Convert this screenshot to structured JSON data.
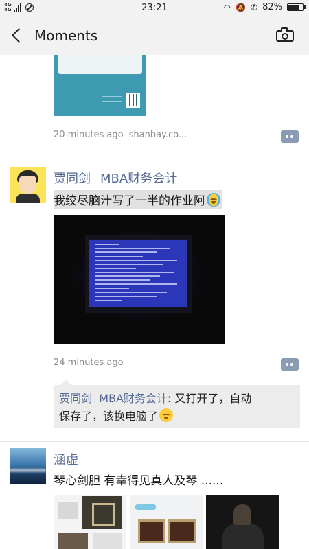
{
  "status_bar": {
    "network_top": "4G",
    "network_bottom": "4G",
    "time": "23:21",
    "battery": "82%",
    "battery_level": 0.82
  },
  "header": {
    "title": "Moments",
    "back_icon": "chevron-left-icon",
    "camera_icon": "camera-icon"
  },
  "posts": [
    {
      "time": "20 minutes ago",
      "source": "shanbay.co..."
    },
    {
      "author": "贾同剑",
      "group": "MBA财务会计",
      "text": "我绞尽脑汁写了一半的作业阿",
      "time": "24 minutes ago",
      "comment": {
        "author": "贾同剑",
        "group": "MBA财务会计",
        "line1": ": 又打开了，自动",
        "line2": "保存了，该换电脑了"
      }
    },
    {
      "author": "涵虚",
      "text": "琴心剑胆 有幸得见真人及琴 ......"
    }
  ]
}
